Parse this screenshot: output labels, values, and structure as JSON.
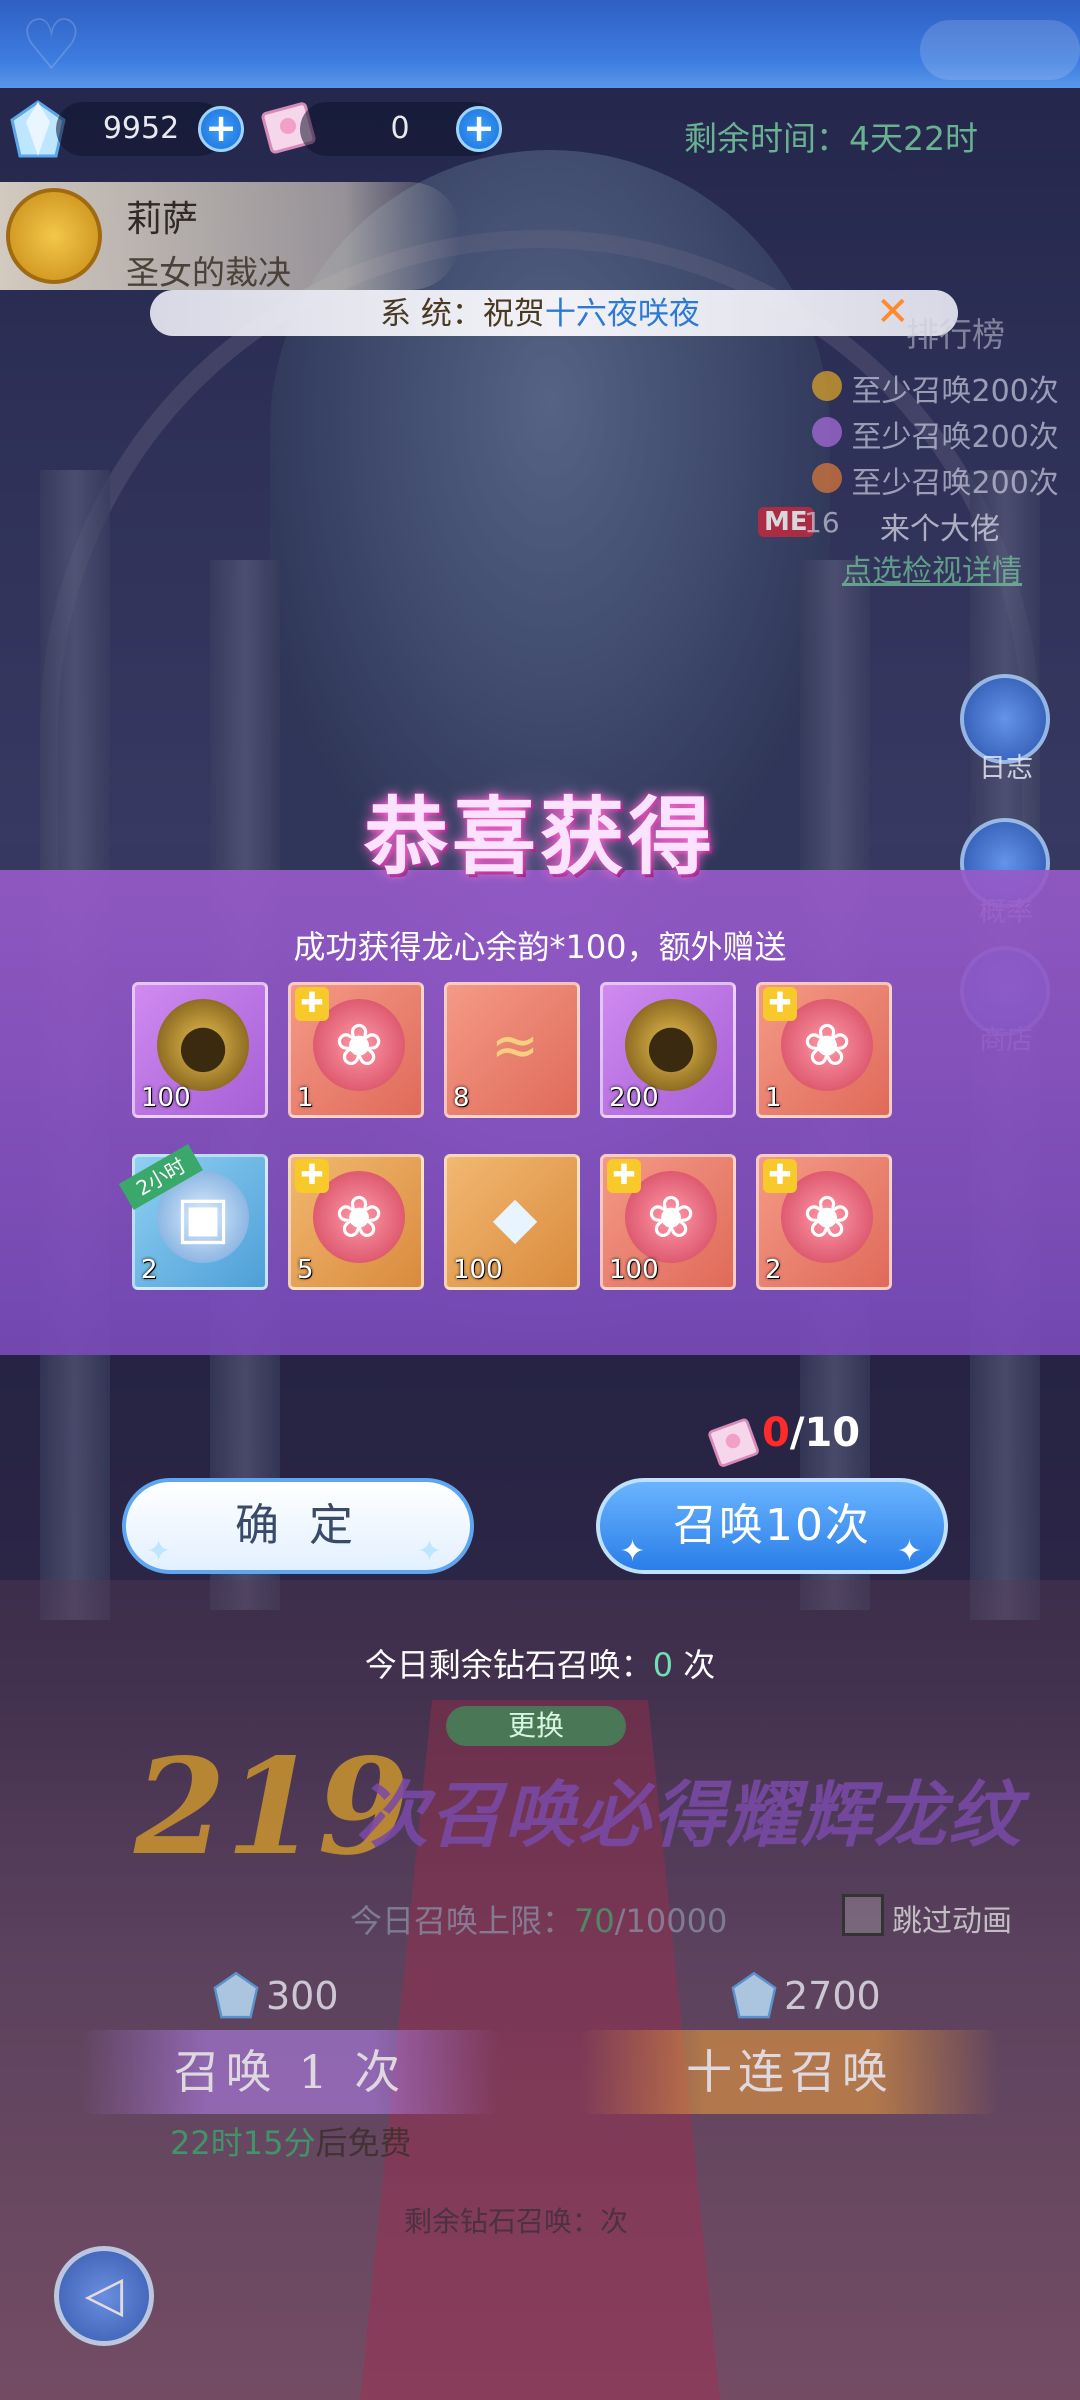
{
  "currency": {
    "diamonds": "9952",
    "tickets": "0"
  },
  "timer": "剩余时间：4天22时",
  "character": {
    "name": "莉萨",
    "title": "圣女的裁决"
  },
  "marquee": {
    "prefix": "系  统：祝贺",
    "highlight": "十六夜咲夜"
  },
  "ranking": {
    "title": "排行榜",
    "rows": [
      "至少召唤200次",
      "至少召唤200次",
      "至少召唤200次"
    ],
    "me_badge": "ME",
    "me_rank": "16",
    "me_name": "来个大佬",
    "link": "点选检视详情"
  },
  "side_menu": {
    "log": "日志",
    "probability": "概率",
    "shop": "商店"
  },
  "popup": {
    "title": "恭喜获得",
    "subtitle": "成功获得龙心余韵*100，额外赠送",
    "items": [
      {
        "count": "100",
        "bg": "purple",
        "icon": "dark-egg-icon"
      },
      {
        "count": "1",
        "bg": "red",
        "icon": "character-shard-icon"
      },
      {
        "count": "8",
        "bg": "red",
        "icon": "dragon-icon"
      },
      {
        "count": "200",
        "bg": "purple",
        "icon": "dark-egg-icon"
      },
      {
        "count": "1",
        "bg": "red",
        "icon": "character-shard-icon"
      },
      {
        "count": "2",
        "bg": "blue",
        "icon": "treasure-chest-icon",
        "tag": "2小时"
      },
      {
        "count": "5",
        "bg": "orange",
        "icon": "character-shard-icon"
      },
      {
        "count": "100",
        "bg": "orange",
        "icon": "crystal-icon"
      },
      {
        "count": "100",
        "bg": "red",
        "icon": "character-shard-icon"
      },
      {
        "count": "2",
        "bg": "red",
        "icon": "character-shard-icon"
      }
    ],
    "ticket_count": "0",
    "ticket_total": "/10",
    "confirm": "确 定",
    "summon10": "召唤10次"
  },
  "daily": {
    "label": "今日剩余钻石召唤：",
    "value": "0",
    "unit": " 次"
  },
  "background_ui": {
    "change": "更换",
    "pity_number": "219",
    "pity_text": "次召唤必得耀辉龙纹",
    "limit_label": "今日召唤上限：",
    "limit_used": "70",
    "limit_total": "/10000",
    "skip_anim": "跳过动画",
    "cost_one": "300",
    "cost_ten": "2700",
    "summon_once": "召唤 1 次",
    "summon_ten": "十连召唤",
    "free_time": "22时15分",
    "free_suffix": "后免费",
    "diamond_left_label": "剩余钻石召唤：",
    "diamond_left_value": "",
    "diamond_left_unit": "次"
  },
  "colors": {
    "accent_green": "#7fe0a8",
    "popup_purple": "#9a5fd0",
    "button_blue": "#2a7ee8"
  }
}
